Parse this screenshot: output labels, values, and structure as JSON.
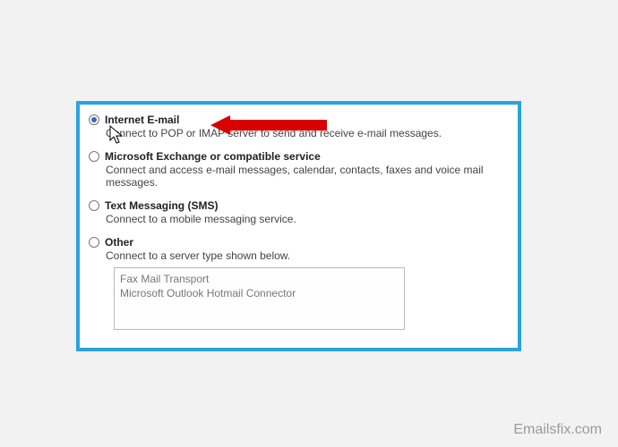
{
  "options": [
    {
      "label": "Internet E-mail",
      "desc": "Connect to POP or IMAP server to send and receive e-mail messages.",
      "selected": true
    },
    {
      "label": "Microsoft Exchange or compatible service",
      "desc": "Connect and access e-mail messages, calendar, contacts, faxes and voice mail messages.",
      "selected": false
    },
    {
      "label": "Text Messaging (SMS)",
      "desc": "Connect to a mobile messaging service.",
      "selected": false
    },
    {
      "label": "Other",
      "desc": "Connect to a server type shown below.",
      "selected": false
    }
  ],
  "other_list": [
    "Fax Mail Transport",
    "Microsoft Outlook Hotmail Connector"
  ],
  "watermark": "Emailsfix.com"
}
